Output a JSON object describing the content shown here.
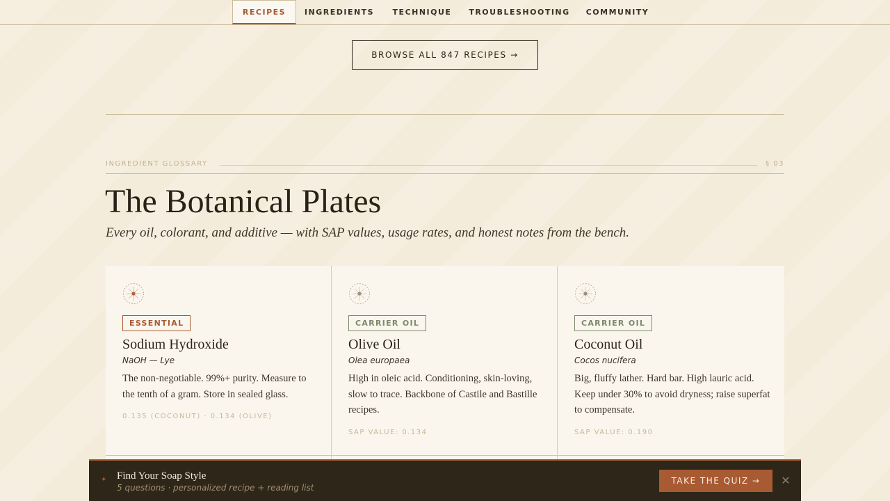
{
  "nav": {
    "tabs": [
      {
        "label": "RECIPES",
        "active": true
      },
      {
        "label": "INGREDIENTS",
        "active": false
      },
      {
        "label": "TECHNIQUE",
        "active": false
      },
      {
        "label": "TROUBLESHOOTING",
        "active": false
      },
      {
        "label": "COMMUNITY",
        "active": false
      }
    ]
  },
  "browse": {
    "label": "BROWSE ALL 847 RECIPES →"
  },
  "section": {
    "eyebrow": "INGREDIENT GLOSSARY",
    "number": "§ 03",
    "title": "The Botanical Plates",
    "subtitle": "Every oil, colorant, and additive — with SAP values, usage rates, and honest notes from the bench."
  },
  "cards": [
    {
      "icon": "sunburst-icon",
      "badge": "ESSENTIAL",
      "name": "Sodium Hydroxide",
      "latin": "NaOH — Lye",
      "description": "The non-negotiable. 99%+ purity. Measure to the tenth of a gram. Store in sealed glass.",
      "sap": "0.135 (COCONUT) · 0.134 (OLIVE)"
    },
    {
      "icon": "sunburst-icon",
      "badge": "CARRIER OIL",
      "name": "Olive Oil",
      "latin": "Olea europaea",
      "description": "High in oleic acid. Conditioning, skin-loving, slow to trace. Backbone of Castile and Bastille recipes.",
      "sap": "SAP VALUE: 0.134"
    },
    {
      "icon": "sunburst-icon",
      "badge": "CARRIER OIL",
      "name": "Coconut Oil",
      "latin": "Cocos nucifera",
      "description": "Big, fluffy lather. Hard bar. High lauric acid. Keep under 30% to avoid dryness; raise superfat to compensate.",
      "sap": "SAP VALUE: 0.190"
    }
  ],
  "banner": {
    "mark": "✦",
    "title": "Find Your Soap Style",
    "subtitle": "5 questions · personalized recipe + reading list",
    "cta": "TAKE THE QUIZ →",
    "close": "✕"
  },
  "colors": {
    "background": "#f4ecda",
    "accent": "#a85a32",
    "carrier": "#7b8a68",
    "banner": "#2e2619"
  }
}
